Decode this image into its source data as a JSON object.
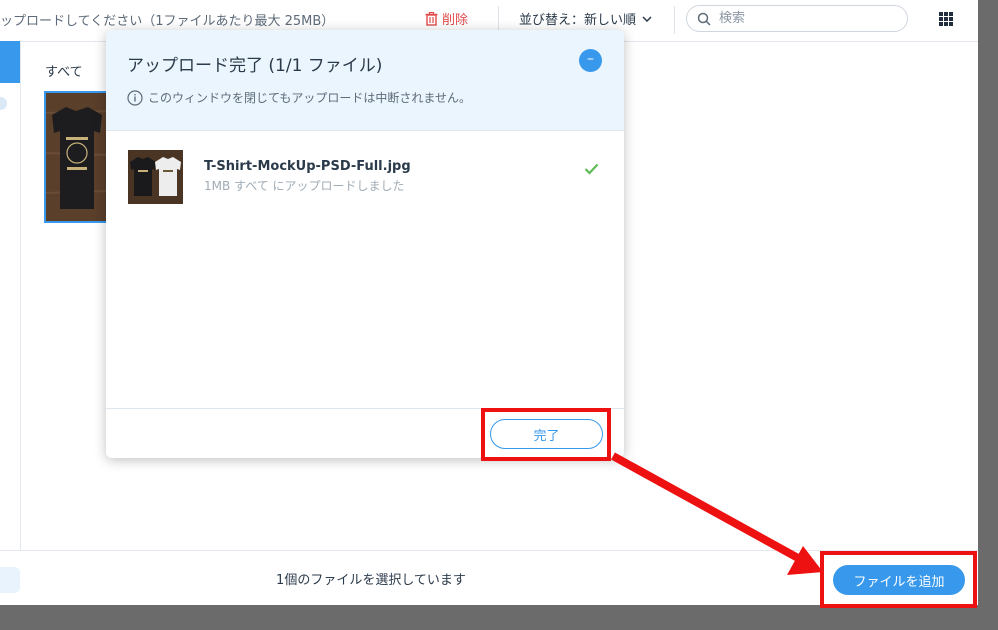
{
  "toolbar": {
    "hint": "ップロードしてください（1ファイルあたり最大 25MB）",
    "delete_label": "削除",
    "sort_label": "並び替え：新しい順",
    "search_placeholder": "検索"
  },
  "sidebar": {
    "folder_label": "すべて"
  },
  "dialog": {
    "title": "アップロード完了 (1/1 ファイル)",
    "minimize_label": "–",
    "info": "このウィンドウを閉じてもアップロードは中断されません。",
    "file": {
      "name": "T-Shirt-MockUp-PSD-Full.jpg",
      "status": "1MB すべて にアップロードしました"
    },
    "done_label": "完了"
  },
  "footer": {
    "status": "1個のファイルを選択しています",
    "add_button": "ファイルを追加"
  },
  "colors": {
    "accent": "#3899ec",
    "delete": "#e04a4a",
    "highlight": "#ee1111",
    "success": "#60bc57"
  },
  "icons": [
    "trash-icon",
    "chevron-down-icon",
    "search-icon",
    "grid-view-icon",
    "info-icon",
    "check-icon",
    "minimize-icon"
  ]
}
